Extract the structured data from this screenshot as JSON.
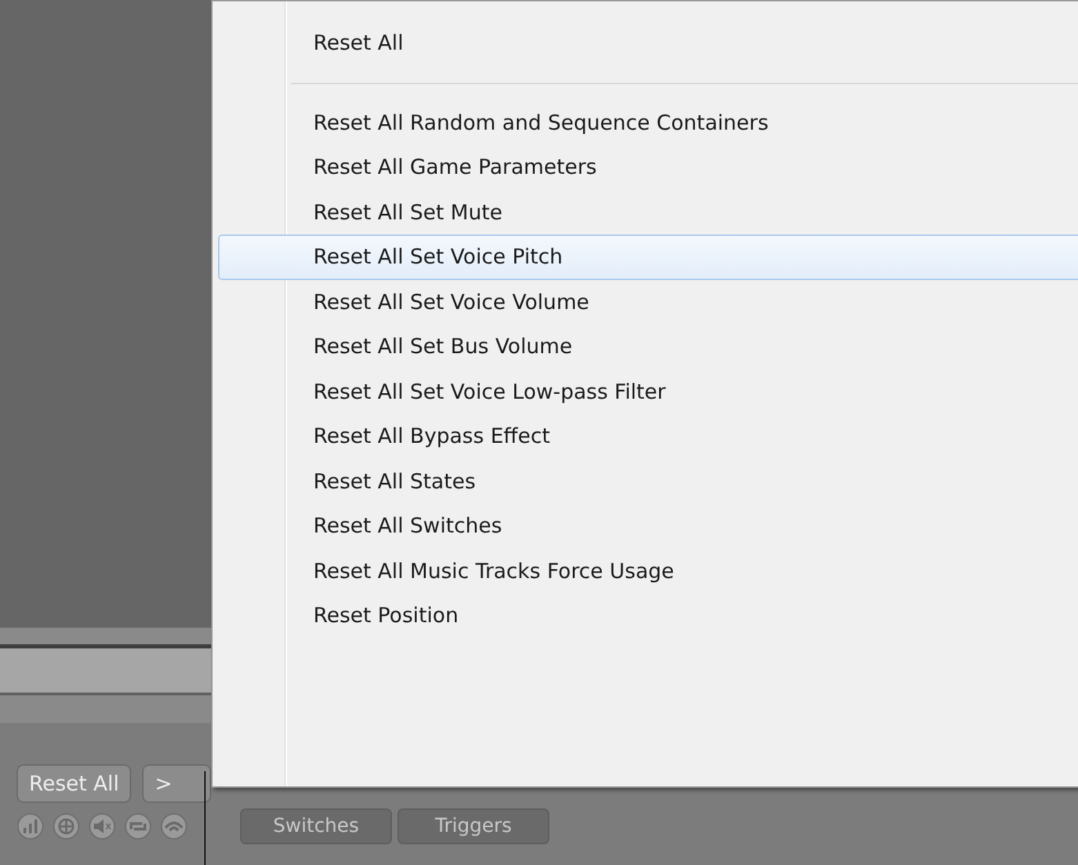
{
  "menu": {
    "items": [
      {
        "kind": "item",
        "label": "Reset All",
        "selected": false
      },
      {
        "kind": "separator"
      },
      {
        "kind": "item",
        "label": "Reset All Random and Sequence Containers",
        "selected": false
      },
      {
        "kind": "item",
        "label": "Reset All Game Parameters",
        "selected": false
      },
      {
        "kind": "item",
        "label": "Reset All Set Mute",
        "selected": false
      },
      {
        "kind": "item",
        "label": "Reset All Set Voice Pitch",
        "selected": true
      },
      {
        "kind": "item",
        "label": "Reset All Set Voice Volume",
        "selected": false
      },
      {
        "kind": "item",
        "label": "Reset All Set Bus Volume",
        "selected": false
      },
      {
        "kind": "item",
        "label": "Reset All Set Voice Low-pass Filter",
        "selected": false
      },
      {
        "kind": "item",
        "label": "Reset All Bypass Effect",
        "selected": false
      },
      {
        "kind": "item",
        "label": "Reset All States",
        "selected": false
      },
      {
        "kind": "item",
        "label": "Reset All Switches",
        "selected": false
      },
      {
        "kind": "item",
        "label": "Reset All Music Tracks Force Usage",
        "selected": false
      },
      {
        "kind": "item",
        "label": "Reset Position",
        "selected": false
      }
    ]
  },
  "toolbar": {
    "reset_button": "Reset All",
    "more_button": ">"
  },
  "tabs": [
    {
      "label": "Switches",
      "disabled": true
    },
    {
      "label": "Triggers",
      "disabled": true
    }
  ]
}
